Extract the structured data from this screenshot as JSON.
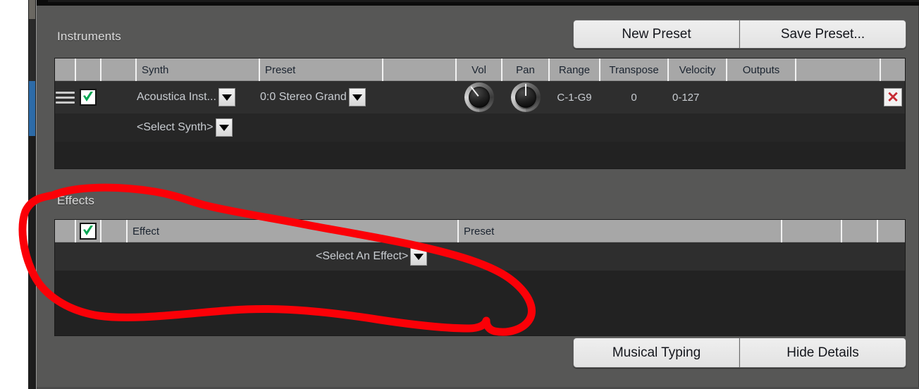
{
  "window": {
    "background_color": "#575756",
    "panel_color": "#2e2e2e",
    "header_color": "#a7a7a7",
    "accent_color": "#2d6ba8",
    "annotation_color": "#fb0007",
    "check_color": "#00a552",
    "delete_color": "#c62a33"
  },
  "instruments": {
    "title": "Instruments",
    "new_preset_label": "New Preset",
    "save_preset_label": "Save Preset...",
    "columns": [
      "",
      "",
      "Synth",
      "Preset",
      "",
      "",
      "Vol",
      "Pan",
      "Range",
      "Transpose",
      "Velocity",
      "Outputs",
      ""
    ],
    "rows": [
      {
        "handle_icon": "hamburger-icon",
        "enabled": true,
        "synth": "Acoustica Inst...",
        "synth_dropdown_icon": "chevron-down-icon",
        "preset": "0:0 Stereo Grand",
        "preset_dropdown_icon": "chevron-down-icon",
        "vol_icon": "knob-icon",
        "pan_icon": "knob-icon",
        "range": "C-1-G9",
        "transpose": "0",
        "velocity": "0-127",
        "outputs": "",
        "delete_icon": "close-icon",
        "delete_label": "✕"
      },
      {
        "synth": "<Select Synth>",
        "synth_dropdown_icon": "chevron-down-icon"
      }
    ]
  },
  "effects": {
    "title": "Effects",
    "columns": [
      "",
      "",
      "Effect",
      "Preset",
      "",
      "",
      ""
    ],
    "header_checkbox_checked": true,
    "rows": [
      {
        "effect": "<Select An Effect>",
        "effect_dropdown_icon": "chevron-down-icon"
      }
    ]
  },
  "footer": {
    "musical_typing_label": "Musical Typing",
    "hide_details_label": "Hide Details"
  },
  "scrollbar": {
    "name": "vertical-scrollbar",
    "thumb_color": "#2d6ba8"
  },
  "annotation": {
    "type": "freehand-ellipse",
    "color": "#fb0007",
    "stroke_width": 11,
    "describes": "Effects section circled in red"
  }
}
